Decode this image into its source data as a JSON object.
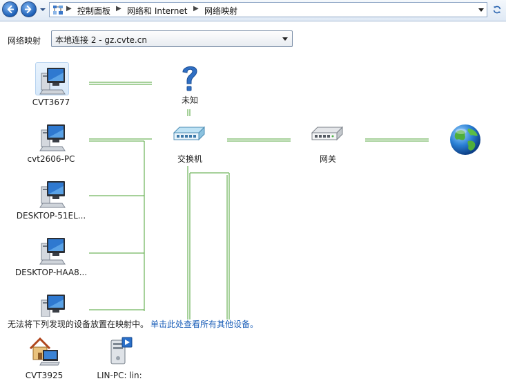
{
  "address_bar": {
    "breadcrumbs": [
      "控制面板",
      "网络和 Internet",
      "网络映射"
    ]
  },
  "toolbar": {
    "map_label": "网络映射",
    "network_select_value": "本地连接 2 - gz.cvte.cn"
  },
  "devices": {
    "pc1": "CVT3677",
    "pc2": "cvt2606-PC",
    "pc3": "DESKTOP-51EL...",
    "pc4": "DESKTOP-HAA8...",
    "unknown": "未知",
    "switch": "交换机",
    "gateway": "网关"
  },
  "notice": {
    "text": "无法将下列发现的设备放置在映射中。",
    "link": "单击此处查看所有其他设备。"
  },
  "unplaced_devices": {
    "home_pc": "CVT3925",
    "media_server": "LIN-PC: lin:"
  },
  "colors": {
    "connection_line": "#4ea334",
    "link_text": "#1a5eb8"
  }
}
